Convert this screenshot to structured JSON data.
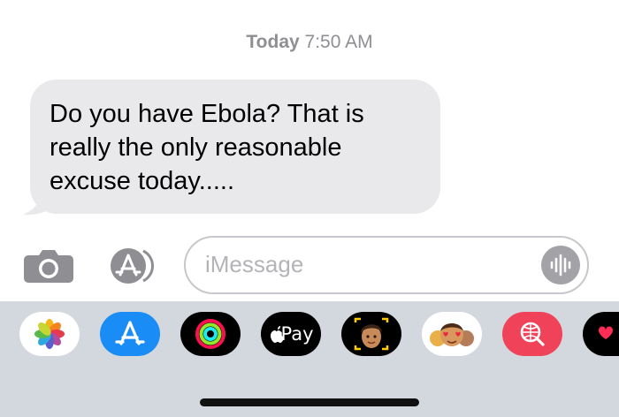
{
  "conversation": {
    "timestamp_day": "Today",
    "timestamp_time": "7:50 AM",
    "messages": [
      {
        "direction": "incoming",
        "lines": [
          "Do you have Ebola? That is",
          "really the only reasonable",
          "excuse today....."
        ]
      }
    ]
  },
  "composer": {
    "placeholder": "iMessage",
    "camera_icon": "camera-icon",
    "apps_icon": "app-store-icon",
    "voice_icon": "waveform-icon"
  },
  "app_drawer": {
    "apps": [
      {
        "name": "photos",
        "icon": "photos-icon"
      },
      {
        "name": "app-store",
        "icon": "app-store-icon"
      },
      {
        "name": "fitness",
        "icon": "activity-rings-icon"
      },
      {
        "name": "apple-pay",
        "label": "Pay",
        "icon": "apple-logo-icon"
      },
      {
        "name": "memoji-camera",
        "icon": "memoji-camera-icon"
      },
      {
        "name": "memoji-stickers",
        "icon": "memoji-stickers-icon"
      },
      {
        "name": "image-search",
        "icon": "globe-search-icon"
      },
      {
        "name": "digital-touch",
        "icon": "heart-icon"
      }
    ]
  },
  "colors": {
    "bubble_incoming": "#e9e9eb",
    "drawer_background": "#d3d8df",
    "app_store_blue": "#1a8cf5",
    "image_search_red": "#f0435a"
  }
}
